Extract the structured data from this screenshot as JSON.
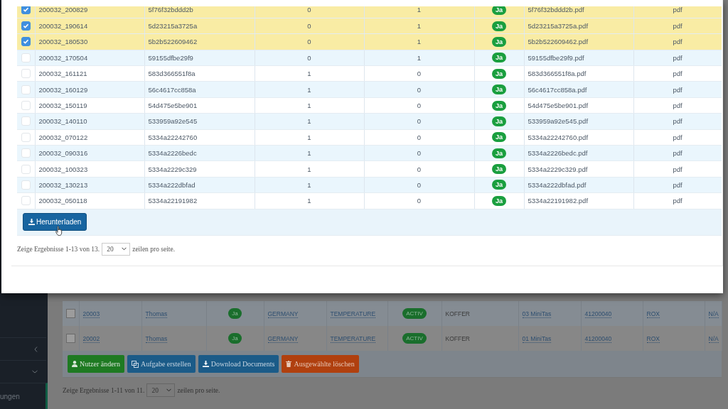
{
  "modal": {
    "table": {
      "rows": [
        {
          "checked": true,
          "column_1": "200032_200829",
          "column_2": "5f76f32bddd2b",
          "column_3": "0",
          "column_4": "1",
          "badge": "Ja",
          "file": "5f76f32bddd2b.pdf",
          "type": "pdf"
        },
        {
          "checked": true,
          "column_1": "200032_190614",
          "column_2": "5d23215a3725a",
          "column_3": "0",
          "column_4": "1",
          "badge": "Ja",
          "file": "5d23215a3725a.pdf",
          "type": "pdf"
        },
        {
          "checked": true,
          "column_1": "200032_180530",
          "column_2": "5b2b522609462",
          "column_3": "0",
          "column_4": "1",
          "badge": "Ja",
          "file": "5b2b522609462.pdf",
          "type": "pdf"
        },
        {
          "checked": false,
          "column_1": "200032_170504",
          "column_2": "59155dfbe29f9",
          "column_3": "0",
          "column_4": "1",
          "badge": "Ja",
          "file": "59155dfbe29f9.pdf",
          "type": "pdf"
        },
        {
          "checked": false,
          "column_1": "200032_161121",
          "column_2": "583d366551f8a",
          "column_3": "1",
          "column_4": "0",
          "badge": "Ja",
          "file": "583d366551f8a.pdf",
          "type": "pdf"
        },
        {
          "checked": false,
          "column_1": "200032_160129",
          "column_2": "56c4617cc858a",
          "column_3": "1",
          "column_4": "0",
          "badge": "Ja",
          "file": "56c4617cc858a.pdf",
          "type": "pdf"
        },
        {
          "checked": false,
          "column_1": "200032_150119",
          "column_2": "54d475e5be901",
          "column_3": "1",
          "column_4": "0",
          "badge": "Ja",
          "file": "54d475e5be901.pdf",
          "type": "pdf"
        },
        {
          "checked": false,
          "column_1": "200032_140110",
          "column_2": "533959a92e545",
          "column_3": "1",
          "column_4": "0",
          "badge": "Ja",
          "file": "533959a92e545.pdf",
          "type": "pdf"
        },
        {
          "checked": false,
          "column_1": "200032_070122",
          "column_2": "5334a22242760",
          "column_3": "1",
          "column_4": "0",
          "badge": "Ja",
          "file": "5334a22242760.pdf",
          "type": "pdf"
        },
        {
          "checked": false,
          "column_1": "200032_090316",
          "column_2": "5334a2226bedc",
          "column_3": "1",
          "column_4": "0",
          "badge": "Ja",
          "file": "5334a2226bedc.pdf",
          "type": "pdf"
        },
        {
          "checked": false,
          "column_1": "200032_100323",
          "column_2": "5334a2229c329",
          "column_3": "1",
          "column_4": "0",
          "badge": "Ja",
          "file": "5334a2229c329.pdf",
          "type": "pdf"
        },
        {
          "checked": false,
          "column_1": "200032_130213",
          "column_2": "5334a222dbfad",
          "column_3": "1",
          "column_4": "0",
          "badge": "Ja",
          "file": "5334a222dbfad.pdf",
          "type": "pdf"
        },
        {
          "checked": false,
          "column_1": "200032_050118",
          "column_2": "5334a22191982",
          "column_3": "1",
          "column_4": "0",
          "badge": "Ja",
          "file": "5334a22191982.pdf",
          "type": "pdf"
        }
      ]
    },
    "download_button": "Herunterladen",
    "pagination": {
      "summary": "Zeige Ergebnisse 1-13 von 13.",
      "page_size": "20",
      "suffix": "zeilen pro seite."
    }
  },
  "background_page": {
    "sidebar": {
      "partial_item": "ungen"
    },
    "table": {
      "rows": [
        {
          "checked": false,
          "cells": [
            {
              "kind": "link",
              "text": "20003"
            },
            {
              "kind": "link",
              "text": "Thomas"
            },
            {
              "kind": "badge",
              "text": "Ja"
            },
            {
              "kind": "link",
              "text": "GERMANY"
            },
            {
              "kind": "link",
              "text": "TEMPERATURE"
            },
            {
              "kind": "badge",
              "text": "ACTIV"
            },
            {
              "kind": "text",
              "text": "KOFFER"
            },
            {
              "kind": "link",
              "text": "03 MiniTas"
            },
            {
              "kind": "link",
              "text": "41200040"
            },
            {
              "kind": "link",
              "text": "ROX"
            },
            {
              "kind": "link",
              "text": "N/A"
            }
          ]
        },
        {
          "checked": false,
          "cells": [
            {
              "kind": "link",
              "text": "20002"
            },
            {
              "kind": "link",
              "text": "Thomas"
            },
            {
              "kind": "badge",
              "text": "Ja"
            },
            {
              "kind": "link",
              "text": "GERMANY"
            },
            {
              "kind": "link",
              "text": "TEMPERATURE"
            },
            {
              "kind": "badge",
              "text": "ACTIV"
            },
            {
              "kind": "text",
              "text": "KOFFER"
            },
            {
              "kind": "link",
              "text": "01 MiniTas"
            },
            {
              "kind": "link",
              "text": "41200040"
            },
            {
              "kind": "link",
              "text": "ROX"
            },
            {
              "kind": "link",
              "text": "N/A"
            }
          ]
        }
      ]
    },
    "buttons": [
      {
        "kind": "edit-user",
        "label": "Nutzer ändern"
      },
      {
        "kind": "create-task",
        "label": "Aufgabe erstellen"
      },
      {
        "kind": "download",
        "label": "Download Documents"
      },
      {
        "kind": "delete",
        "label": "Ausgewählte löschen"
      }
    ],
    "pagination": {
      "summary": "Zeige Ergebnisse 1-11 von 11.",
      "page_size": "20",
      "suffix": "zeilen pro seite."
    }
  }
}
